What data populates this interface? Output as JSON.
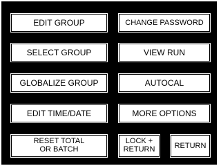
{
  "menu": {
    "edit_group": "EDIT GROUP",
    "change_password": "CHANGE PASSWORD",
    "select_group": "SELECT GROUP",
    "view_run": "VIEW RUN",
    "globalize_group": "GLOBALIZE GROUP",
    "autocal": "AUTOCAL",
    "edit_time_date": "EDIT TIME/DATE",
    "more_options": "MORE OPTIONS",
    "reset_total_or_batch": "RESET TOTAL\nOR BATCH",
    "lock_return": "LOCK +\nRETURN",
    "return": "RETURN"
  },
  "colors": {
    "frame": "#000000",
    "button_face": "#ffffff",
    "text": "#000000"
  }
}
